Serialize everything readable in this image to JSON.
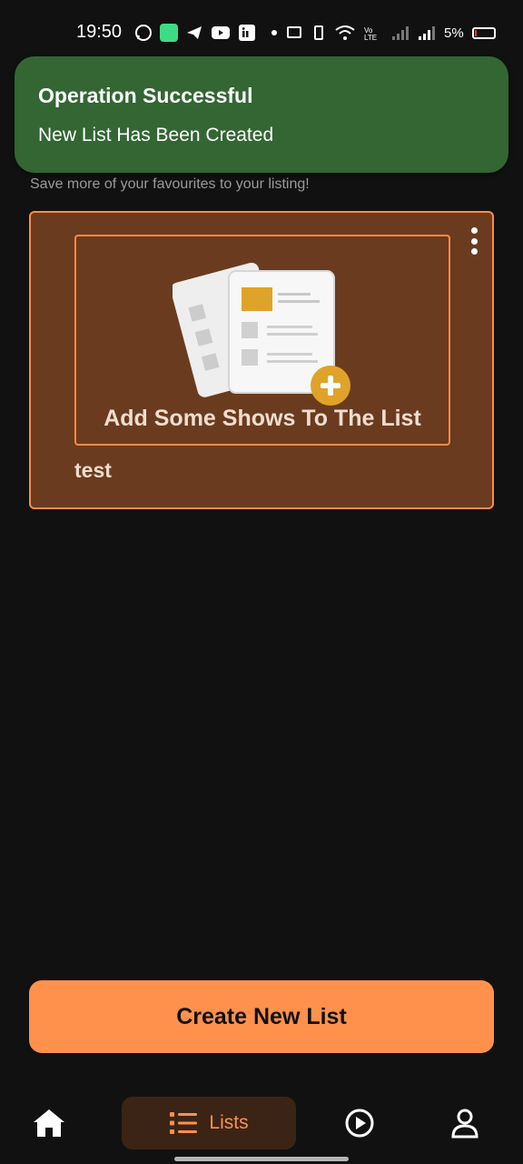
{
  "status_bar": {
    "time": "19:50",
    "battery_percent": "5%",
    "icons": [
      "whatsapp-icon",
      "battery-saver-icon",
      "telegram-icon",
      "youtube-icon",
      "linkedin-icon",
      "dot-icon",
      "cast-icon",
      "vibrate-icon",
      "wifi-icon",
      "volte-icon",
      "signal-icon",
      "signal-icon"
    ]
  },
  "toast": {
    "title": "Operation Successful",
    "message": "New List Has Been Created",
    "color": "#336633"
  },
  "subtitle": "Save more of your favourites to your listing!",
  "list_card": {
    "empty_text": "Add Some Shows To The List",
    "list_name": "test",
    "accent": "#ff8c42",
    "background": "#6b3b1f"
  },
  "create_button": {
    "label": "Create New List",
    "color": "#ff914d"
  },
  "bottom_nav": {
    "items": [
      {
        "icon": "home-icon",
        "label": ""
      },
      {
        "icon": "list-icon",
        "label": "Lists",
        "active": true
      },
      {
        "icon": "play-circle-icon",
        "label": ""
      },
      {
        "icon": "profile-icon",
        "label": ""
      }
    ]
  }
}
